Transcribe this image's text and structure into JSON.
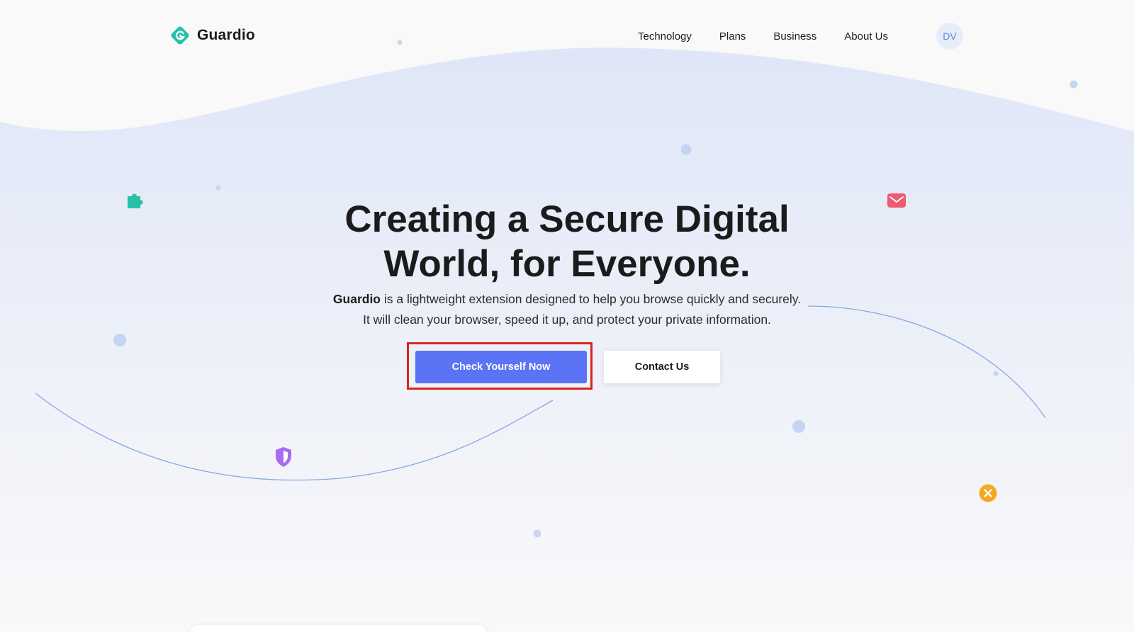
{
  "header": {
    "logo_text": "Guardio",
    "nav": [
      {
        "label": "Technology"
      },
      {
        "label": "Plans"
      },
      {
        "label": "Business"
      },
      {
        "label": "About Us"
      }
    ],
    "avatar_initials": "DV"
  },
  "hero": {
    "title_line1": "Creating a Secure Digital",
    "title_line2": "World, for Everyone.",
    "subtitle_brand": "Guardio",
    "subtitle_rest_line1": " is a lightweight extension designed to help you browse quickly and securely.",
    "subtitle_line2": "It will clean your browser, speed it up, and protect your private information.",
    "primary_button": "Check Yourself Now",
    "secondary_button": "Contact Us"
  },
  "decorations": {
    "icons": [
      "puzzle-icon",
      "mail-icon",
      "shield-icon",
      "close-circle-icon"
    ],
    "colors": {
      "brand_teal": "#27c0a9",
      "primary_button": "#5b73f5",
      "mail_red": "#ee5a6f",
      "shield_purple": "#a66cf2",
      "close_orange": "#f7a823",
      "highlight_red": "#d9261c"
    }
  }
}
